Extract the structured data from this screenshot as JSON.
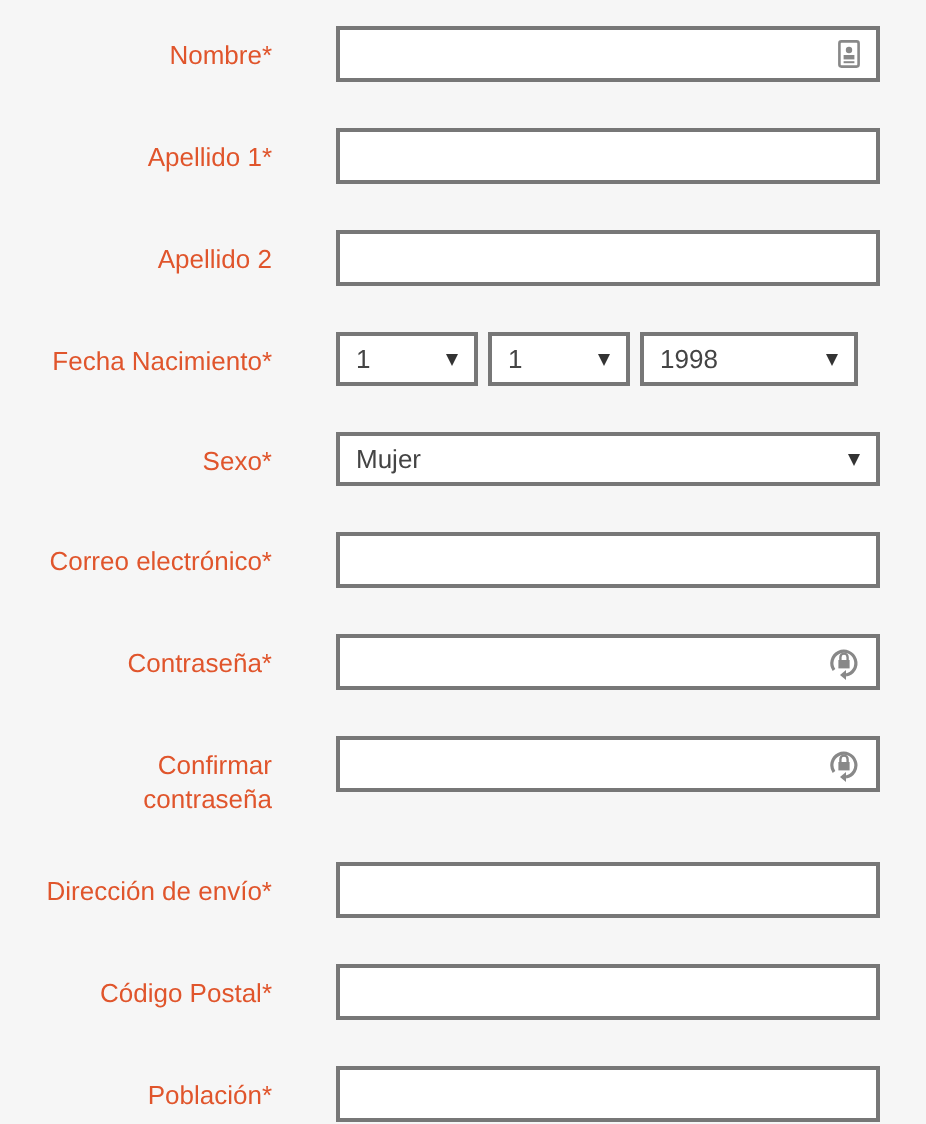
{
  "fields": [
    {
      "label": "Nombre*",
      "kind": "contact"
    },
    {
      "label": "Apellido 1*",
      "kind": "text"
    },
    {
      "label": "Apellido 2",
      "kind": "text"
    },
    {
      "label": "Fecha Nacimiento*",
      "kind": "date",
      "parts": [
        "1",
        "1",
        "1998"
      ]
    },
    {
      "label": "Sexo*",
      "kind": "select",
      "value": "Mujer"
    },
    {
      "label": "Correo electrónico*",
      "kind": "text"
    },
    {
      "label": "Contraseña*",
      "kind": "password"
    },
    {
      "label": "Confirmar contraseña",
      "kind": "password"
    },
    {
      "label": "Dirección de envío*",
      "kind": "text"
    },
    {
      "label": "Código Postal*",
      "kind": "text"
    },
    {
      "label": "Población*",
      "kind": "text"
    }
  ]
}
